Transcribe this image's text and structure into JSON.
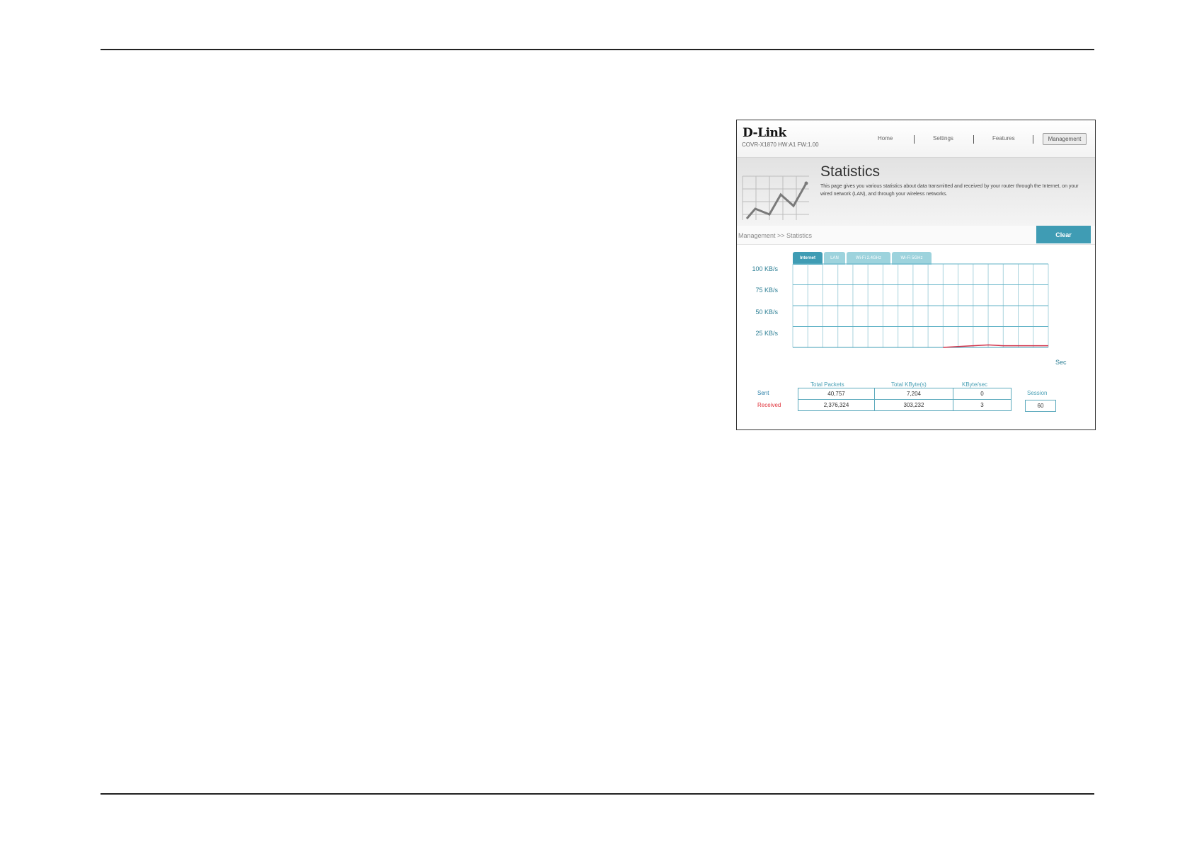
{
  "header": {
    "logo": "D-Link",
    "model": "COVR-X1870 HW:A1 FW:1.00",
    "nav": {
      "home": "Home",
      "settings": "Settings",
      "features": "Features",
      "management": "Management"
    }
  },
  "banner": {
    "title": "Statistics",
    "description": "This page gives you various statistics about data transmitted and received by your router through the Internet, on your wired network (LAN), and through your wireless networks."
  },
  "breadcrumb": "Management >> Statistics",
  "clear_label": "Clear",
  "tabs": [
    {
      "label": "Internet",
      "active": true
    },
    {
      "label": "LAN",
      "active": false
    },
    {
      "label": "Wi-Fi 2.4GHz",
      "active": false
    },
    {
      "label": "Wi-Fi 5GHz",
      "active": false
    }
  ],
  "chart_data": {
    "type": "line",
    "y_tick_labels": [
      "100 KB/s",
      "75 KB/s",
      "50 KB/s",
      "25 KB/s"
    ],
    "ylim": [
      0,
      100
    ],
    "xlabel": "Sec",
    "grid": true,
    "series": [
      {
        "color": "#d2334a",
        "values": [
          null,
          null,
          null,
          null,
          null,
          null,
          null,
          null,
          null,
          null,
          0,
          1,
          2,
          3,
          2,
          2,
          2
        ]
      }
    ],
    "accent_color": "#3f9cb4"
  },
  "stats": {
    "columns": [
      "Total Packets",
      "Total KByte(s)",
      "KByte/sec"
    ],
    "rows": [
      {
        "label": "Sent",
        "values": [
          "40,757",
          "7,204",
          "0"
        ],
        "color": "#2a7fa8"
      },
      {
        "label": "Received",
        "values": [
          "2,376,324",
          "303,232",
          "3"
        ],
        "color": "#e0333b"
      }
    ],
    "session_label": "Session",
    "session_value": "60"
  }
}
